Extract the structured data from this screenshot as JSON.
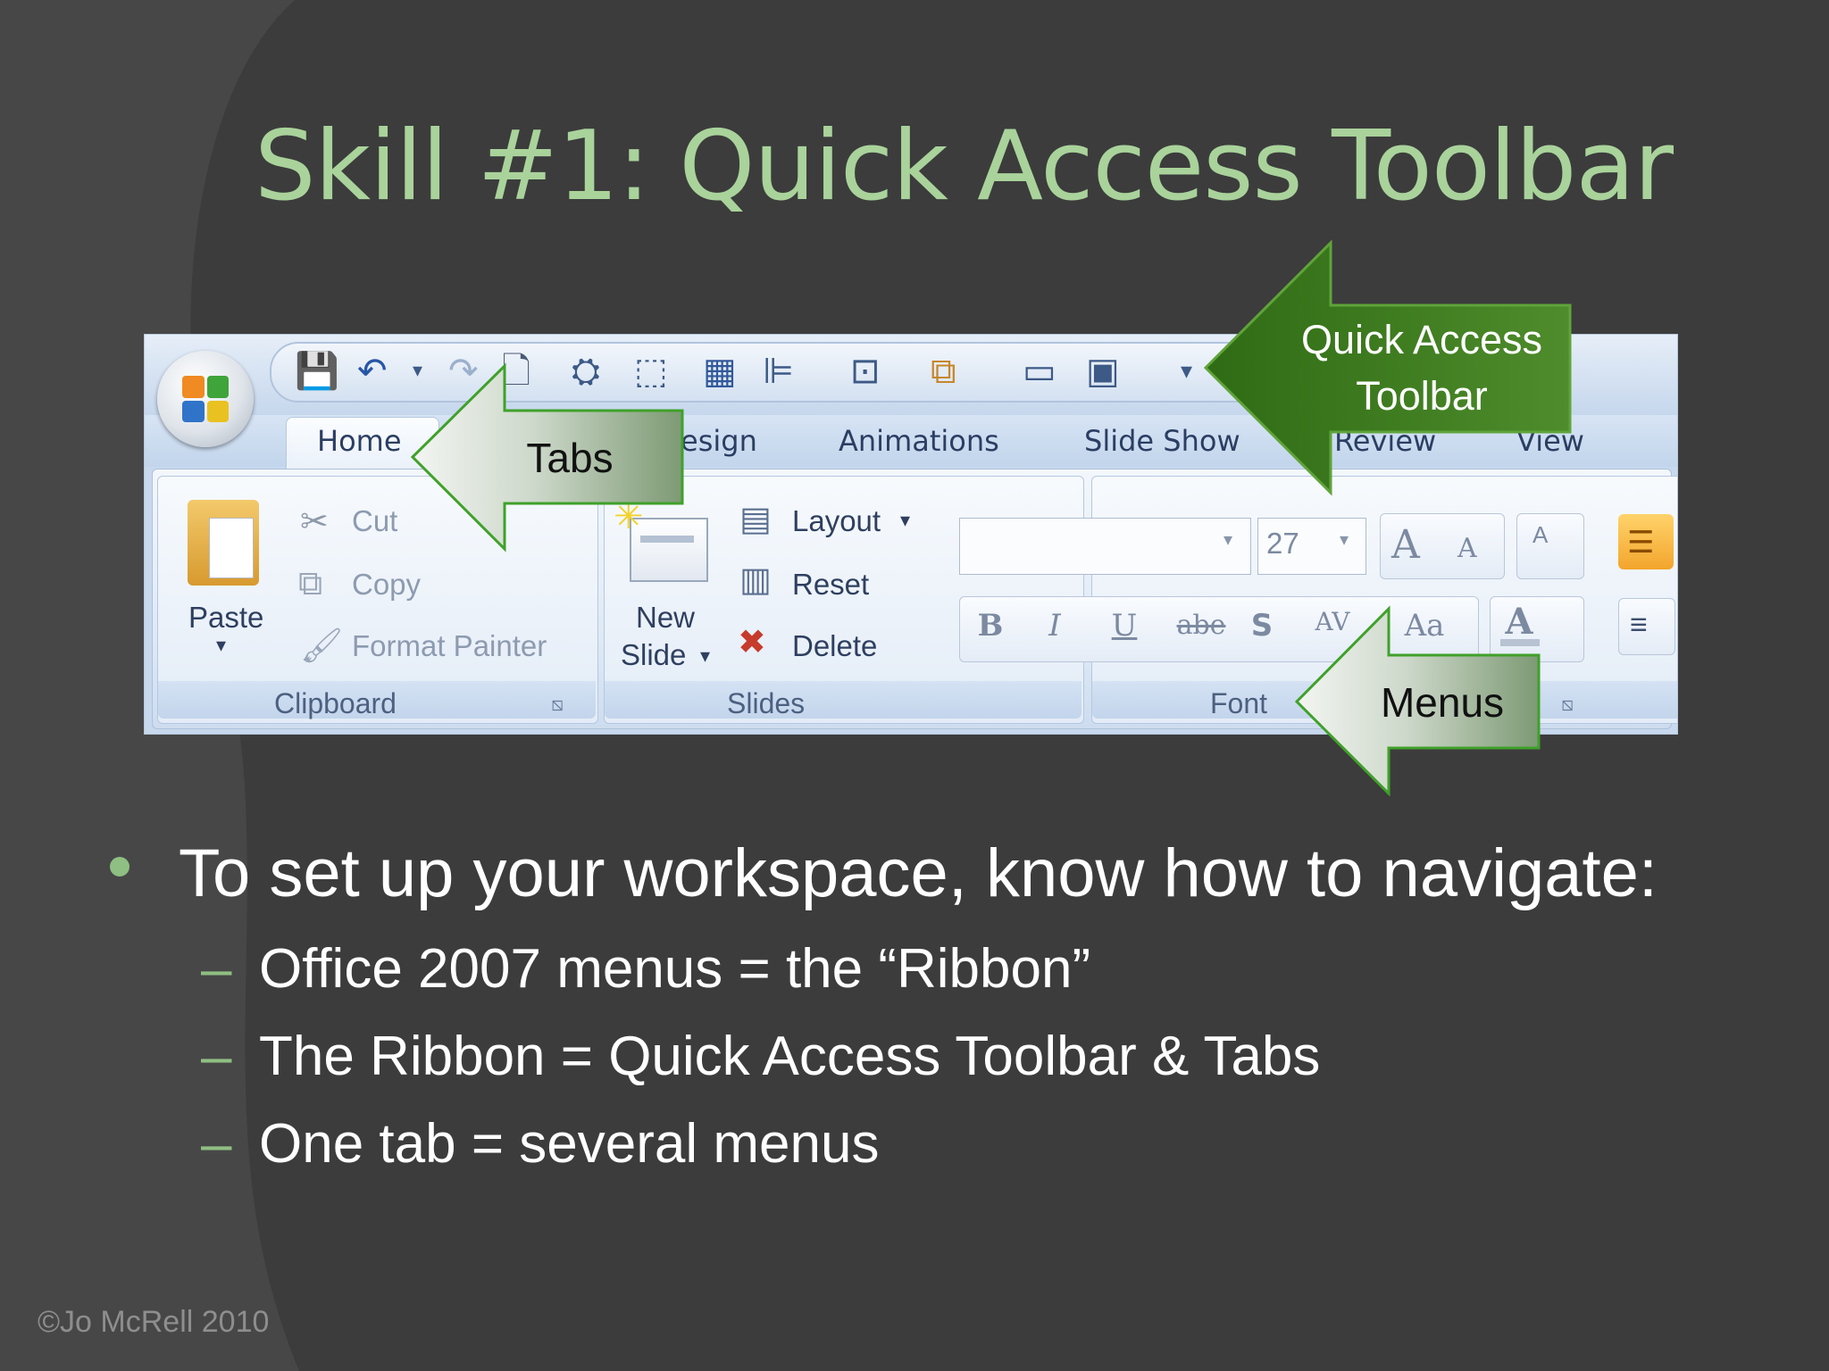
{
  "slide": {
    "title": "Skill #1: Quick Access Toolbar",
    "copyright": "©Jo McRell 2010"
  },
  "ribbon": {
    "tabs": [
      "Home",
      "esign",
      "Animations",
      "Slide Show",
      "Review",
      "View"
    ],
    "clipboard": {
      "paste": "Paste",
      "cut": "Cut",
      "copy": "Copy",
      "format_painter": "Format Painter",
      "label": "Clipboard"
    },
    "slides": {
      "new_slide_line1": "New",
      "new_slide_line2": "Slide",
      "layout": "Layout",
      "reset": "Reset",
      "delete": "Delete",
      "label": "Slides"
    },
    "font": {
      "font_size": "27",
      "label": "Font",
      "bold": "B",
      "italic": "I",
      "underline": "U",
      "strike": "abe",
      "shadow": "S",
      "spacing": "AV",
      "change_case": "Aa",
      "grow": "A",
      "shrink": "A",
      "clear": "A",
      "color": "A"
    }
  },
  "callouts": {
    "qat_line1": "Quick Access",
    "qat_line2": "Toolbar",
    "tabs": "Tabs",
    "menus": "Menus"
  },
  "bullets": {
    "main": "To set up your workspace, know how to navigate:",
    "sub": [
      "Office 2007 menus = the “Ribbon”",
      "The Ribbon = Quick Access Toolbar & Tabs",
      "One tab = several menus"
    ],
    "dash": "–"
  },
  "colors": {
    "background": "#3c3c3c",
    "title": "#a9d39b",
    "callout_dark": "#3f7a22",
    "callout_light": "#8fa88a",
    "bullet_accent": "#8fbf82"
  }
}
